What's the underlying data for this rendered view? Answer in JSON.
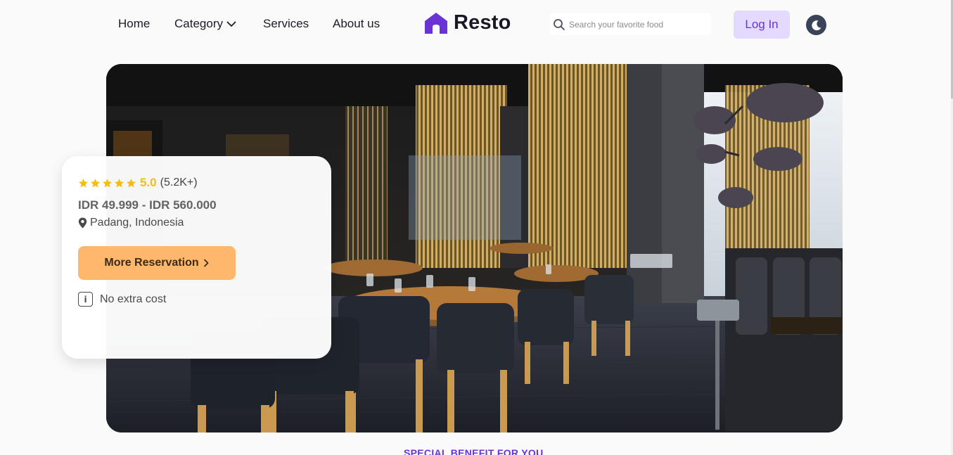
{
  "nav": {
    "links": [
      "Home",
      "Category",
      "Services",
      "About us"
    ],
    "category_icon": "chevron-down-icon"
  },
  "brand": {
    "name": "Resto",
    "logo_icon": "house-icon",
    "logo_color": "#6b33d6"
  },
  "search": {
    "placeholder": "Search your favorite food",
    "value": "",
    "icon": "search-icon"
  },
  "auth": {
    "login_label": "Log In"
  },
  "theme": {
    "toggle_icon": "moon-icon"
  },
  "hero": {
    "image": "restaurant-interior-photo"
  },
  "card": {
    "stars": 5,
    "rating": "5.0",
    "reviews": "(5.2K+)",
    "price": "IDR 49.999 - IDR 560.000",
    "location": "Padang, Indonesia",
    "location_icon": "map-pin-icon",
    "reserve_label": "More Reservation",
    "reserve_icon": "chevron-right-icon",
    "note": "No extra cost",
    "note_icon": "info-icon",
    "info_glyph": "i"
  },
  "section": {
    "label": "SPECIAL BENEFIT FOR YOU"
  },
  "colors": {
    "accent": "#6b33d6",
    "login_bg": "#e4d9ff",
    "reserve_bg": "#ffb86b",
    "star": "#f4bd0f"
  }
}
